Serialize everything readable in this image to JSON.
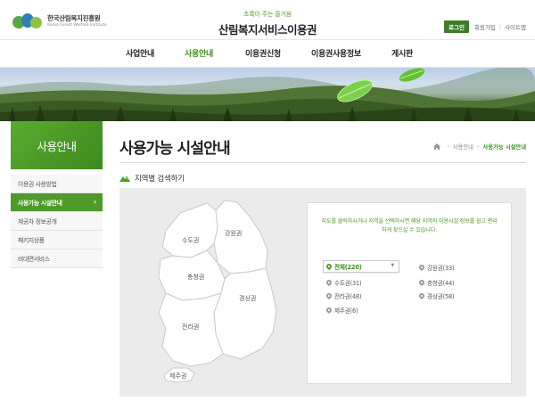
{
  "header": {
    "logo_name": "한국산림복지진흥원",
    "logo_name_en": "Korea Forest Welfare Institute",
    "site_tagline": "초록이 주는 즐거움",
    "site_title": "산림복지서비스이용권",
    "login_label": "로그인",
    "signup_label": "회원가입",
    "sitemap_label": "사이트맵",
    "brand_color": "#3d7d2a"
  },
  "gnb": {
    "items": [
      {
        "label": "사업안내"
      },
      {
        "label": "사용안내"
      },
      {
        "label": "이용권신청"
      },
      {
        "label": "이용권사용정보"
      },
      {
        "label": "게시판"
      }
    ],
    "active_index": 1
  },
  "sidebar": {
    "title": "사용안내",
    "items": [
      {
        "label": "이용권 사용방법"
      },
      {
        "label": "사용가능 시설안내"
      },
      {
        "label": "제공자 정보공개"
      },
      {
        "label": "패키지상품"
      },
      {
        "label": "비대면서비스"
      }
    ],
    "active_index": 1
  },
  "content": {
    "page_title": "사용가능 시설안내",
    "breadcrumb": [
      "사용안내",
      "사용가능 시설안내"
    ],
    "section_title": "지역별 검색하기",
    "instruction": "지도를 클릭하시거나 지역을 선택하시면 해당 지역의 이용시설 정보를 쉽고 편리하게 찾으실 수 있습니다."
  },
  "map": {
    "labels": [
      "수도권",
      "강원권",
      "충청권",
      "경상권",
      "전라권",
      "제주권"
    ]
  },
  "regions": [
    {
      "label": "전체(220)",
      "selected": true
    },
    {
      "label": "강원권(33)"
    },
    {
      "label": "수도권(31)"
    },
    {
      "label": "충청권(44)"
    },
    {
      "label": "전라권(48)"
    },
    {
      "label": "경상권(58)"
    },
    {
      "label": "제주권(6)"
    }
  ],
  "colors": {
    "accent_green": "#4e9a2a",
    "panel_gray": "#ebebeb"
  }
}
